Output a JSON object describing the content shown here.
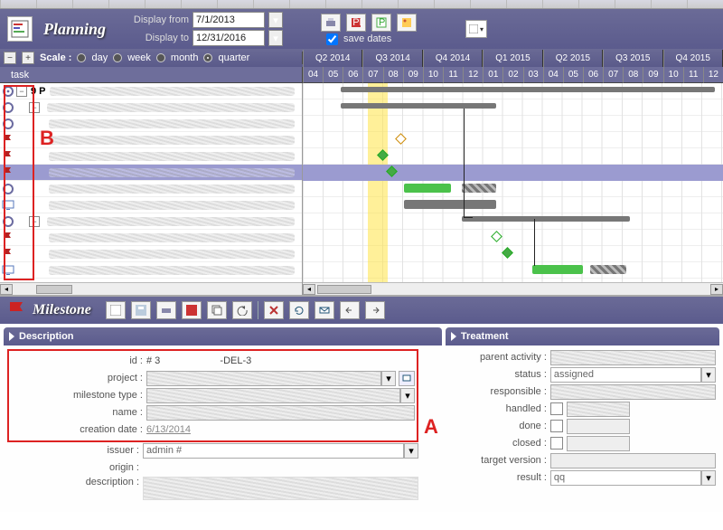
{
  "header": {
    "title": "Planning",
    "display_from_label": "Display from",
    "display_to_label": "Display to",
    "display_from": "7/1/2013",
    "display_to": "12/31/2016",
    "save_dates_label": "save dates",
    "save_dates_checked": true
  },
  "scale": {
    "label": "Scale :",
    "options": [
      "day",
      "week",
      "month",
      "quarter"
    ],
    "selected": "quarter"
  },
  "task_column_header": "task",
  "quarters": [
    "Q2 2014",
    "Q3 2014",
    "Q4 2014",
    "Q1 2015",
    "Q2 2015",
    "Q3 2015",
    "Q4 2015"
  ],
  "months": [
    "04",
    "05",
    "06",
    "07",
    "08",
    "09",
    "10",
    "11",
    "12",
    "01",
    "02",
    "03",
    "04",
    "05",
    "06",
    "07",
    "08",
    "09",
    "10",
    "11",
    "12"
  ],
  "task_list_root": "9 P",
  "detail": {
    "title": "Milestone",
    "description_section": "Description",
    "treatment_section": "Treatment",
    "fields_left": {
      "id_label": "id :",
      "id_value": "# 3",
      "id_suffix": "-DEL-3",
      "project_label": "project :",
      "milestone_type_label": "milestone type :",
      "name_label": "name :",
      "creation_date_label": "creation date :",
      "creation_date": "6/13/2014",
      "issuer_label": "issuer :",
      "issuer": "admin #",
      "origin_label": "origin :",
      "description_label": "description :"
    },
    "fields_right": {
      "parent_activity_label": "parent activity :",
      "status_label": "status :",
      "status": "assigned",
      "responsible_label": "responsible :",
      "handled_label": "handled :",
      "done_label": "done :",
      "closed_label": "closed :",
      "target_version_label": "target version :",
      "result_label": "result :",
      "result": "qq"
    }
  },
  "annotations": {
    "A": "A",
    "B": "B"
  }
}
